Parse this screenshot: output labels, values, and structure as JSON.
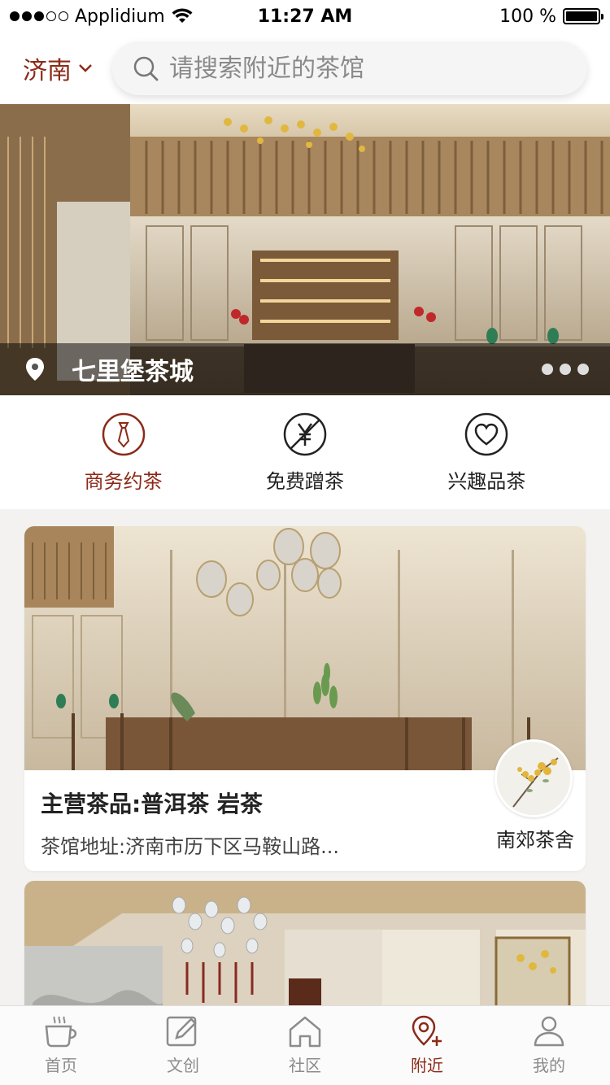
{
  "status_bar": {
    "carrier": "Applidium",
    "time": "11:27 AM",
    "battery": "100 %"
  },
  "header": {
    "city": "济南",
    "search_placeholder": "请搜索附近的茶馆"
  },
  "banner": {
    "title": "七里堡茶城",
    "pages": 3,
    "current_page": 1
  },
  "categories": [
    {
      "label": "商务约茶",
      "icon": "tie-icon",
      "active": true
    },
    {
      "label": "免费蹭茶",
      "icon": "free-yuan-icon",
      "active": false
    },
    {
      "label": "兴趣品茶",
      "icon": "heart-icon",
      "active": false
    }
  ],
  "shops": [
    {
      "main_products": "主营茶品:普洱茶 岩茶",
      "address": "茶馆地址:济南市历下区马鞍山路...",
      "name": "南郊茶舍"
    }
  ],
  "tabbar": [
    {
      "label": "首页",
      "icon": "coffee-cup-icon",
      "active": false
    },
    {
      "label": "文创",
      "icon": "edit-icon",
      "active": false
    },
    {
      "label": "社区",
      "icon": "house-icon",
      "active": false
    },
    {
      "label": "附近",
      "icon": "location-plus-icon",
      "active": true
    },
    {
      "label": "我的",
      "icon": "user-icon",
      "active": false
    }
  ],
  "colors": {
    "accent": "#8b2a18",
    "inactive": "#8c8c8c",
    "background": "#f3f2f1"
  }
}
